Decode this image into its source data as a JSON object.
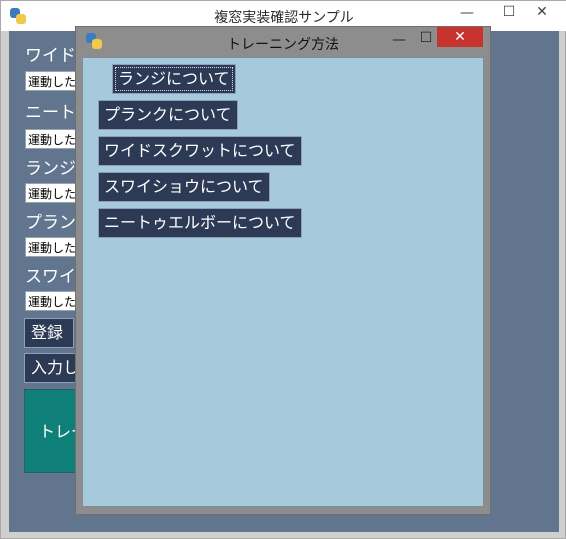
{
  "main_window": {
    "title": "複窓実装確認サンプル",
    "controls": {
      "minimize": "—",
      "maximize": "☐",
      "close": "✕"
    },
    "labels": [
      "ワイドス",
      "ニートゥ",
      "ランジ",
      "プランク",
      "スワイシ"
    ],
    "selects": [
      "運動した",
      "運動した",
      "運動した",
      "運動した",
      "運動した"
    ],
    "register_button": "登録",
    "input_button": "入力し",
    "training_button": "トレー"
  },
  "sub_window": {
    "title": "トレーニング方法",
    "controls": {
      "minimize": "—",
      "maximize": "☐",
      "close": "✕"
    },
    "buttons": [
      "ランジについて",
      "プランクについて",
      "ワイドスクワットについて",
      "スワイショウについて",
      "ニートゥエルボーについて"
    ]
  },
  "colors": {
    "main_bg": "#61758f",
    "button_navy": "#2d3a55",
    "button_teal": "#0f8079",
    "sub_bg": "#a6c9dc",
    "close_red": "#c7342d"
  },
  "icons": [
    "python-app-icon",
    "minimize-icon",
    "maximize-icon",
    "close-icon"
  ]
}
